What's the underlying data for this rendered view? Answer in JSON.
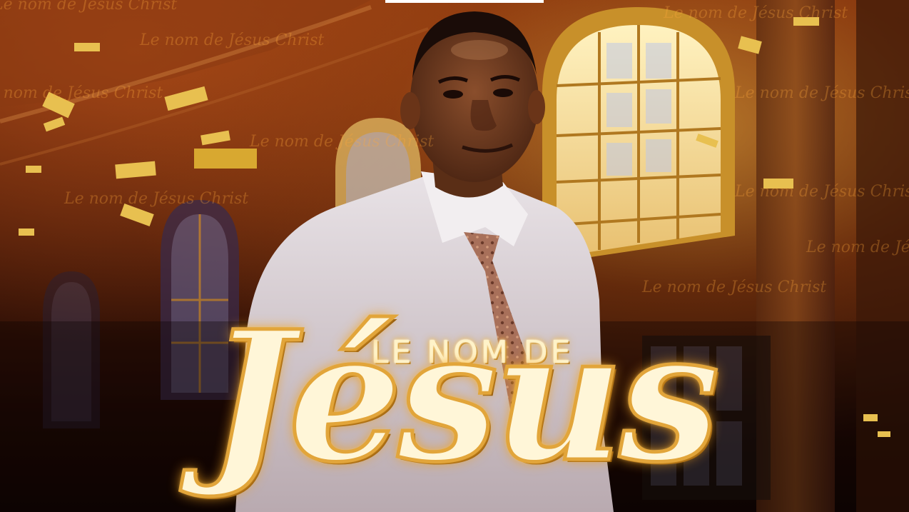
{
  "poster": {
    "subtitle": "LE NOM DE",
    "title": "Jésus",
    "watermark_text": "Le nom de Jésus Christ"
  },
  "colors": {
    "gold": "#e2a53a",
    "glow": "#ffd36a",
    "background_dark": "#1a0a04",
    "window_light": "#f6e3a0"
  }
}
